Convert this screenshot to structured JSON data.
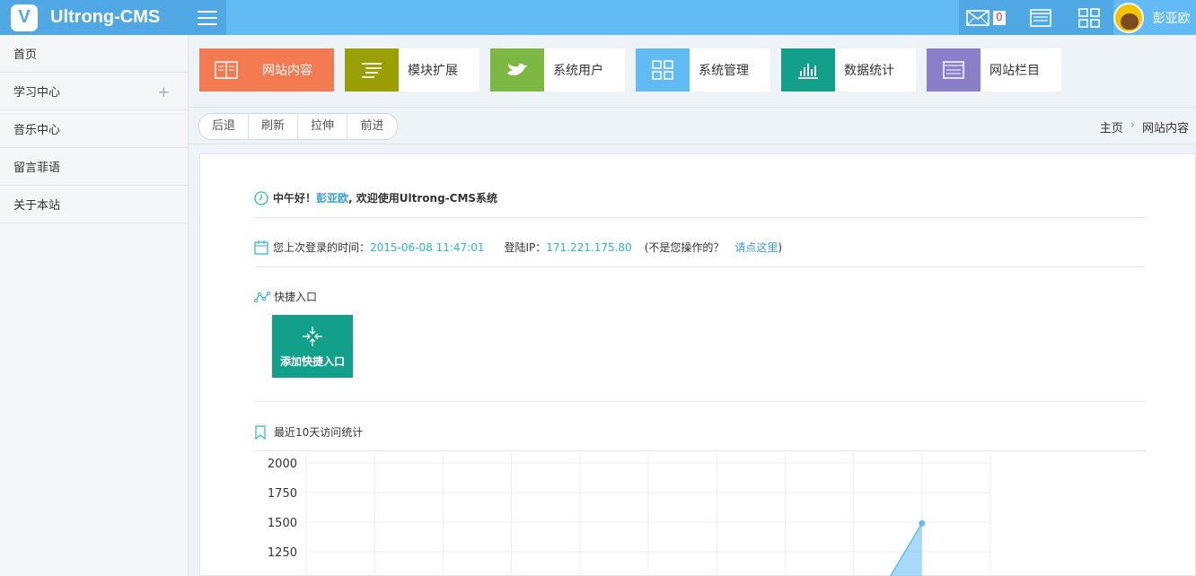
{
  "header": {
    "brand": "Ultrong-CMS",
    "logo_letter": "V",
    "mail_count": "0",
    "username": "彭亚欧",
    "icons": [
      "mail-icon",
      "window-icon",
      "grid-icon",
      "chevron-down-icon"
    ]
  },
  "sidebar": {
    "items": [
      {
        "label": "首页"
      },
      {
        "label": "学习中心",
        "expand": "+"
      },
      {
        "label": "音乐中心"
      },
      {
        "label": "留言菲语"
      },
      {
        "label": "关于本站"
      }
    ]
  },
  "tiles": [
    {
      "label": "网站内容",
      "icon": "content-icon",
      "color": "#f47b51"
    },
    {
      "label": "模块扩展",
      "icon": "list-icon",
      "color": "#9aa004"
    },
    {
      "label": "系统用户",
      "icon": "bird-icon",
      "color": "#7db844"
    },
    {
      "label": "系统管理",
      "icon": "grid-icon",
      "color": "#62bbf5"
    },
    {
      "label": "数据统计",
      "icon": "bar-chart-icon",
      "color": "#12a08a"
    },
    {
      "label": "网站栏目",
      "icon": "window-icon",
      "color": "#8a7fc8"
    }
  ],
  "nav": {
    "buttons": [
      "后退",
      "刷新",
      "拉伸",
      "前进"
    ],
    "breadcrumb": [
      "主页",
      "网站内容"
    ],
    "separator": "›"
  },
  "welcome": {
    "greeting": "中午好！",
    "name": "彭亚欧",
    "suffix": ", 欢迎使用Ultrong-CMS系统"
  },
  "login": {
    "time_label": "您上次登录的时间：",
    "time_value": "2015-06-08 11:47:01",
    "ip_label": "登陆IP：",
    "ip_value": "171.221.175.80",
    "note_prefix": "(不是您操作的？",
    "note_link": "请点这里",
    "note_suffix": ")"
  },
  "quick": {
    "title": "快捷入口",
    "add_label": "添加快捷入口"
  },
  "stats": {
    "title": "最近10天访问统计"
  },
  "chart_data": {
    "type": "area",
    "y_ticks": [
      "2000",
      "1750",
      "1500",
      "1250"
    ],
    "ylim": [
      1250,
      2000
    ],
    "categories_count": 10,
    "visible_points": [
      {
        "index": 9,
        "value": 1490
      }
    ],
    "grid": true,
    "color": "#62bbf5"
  }
}
